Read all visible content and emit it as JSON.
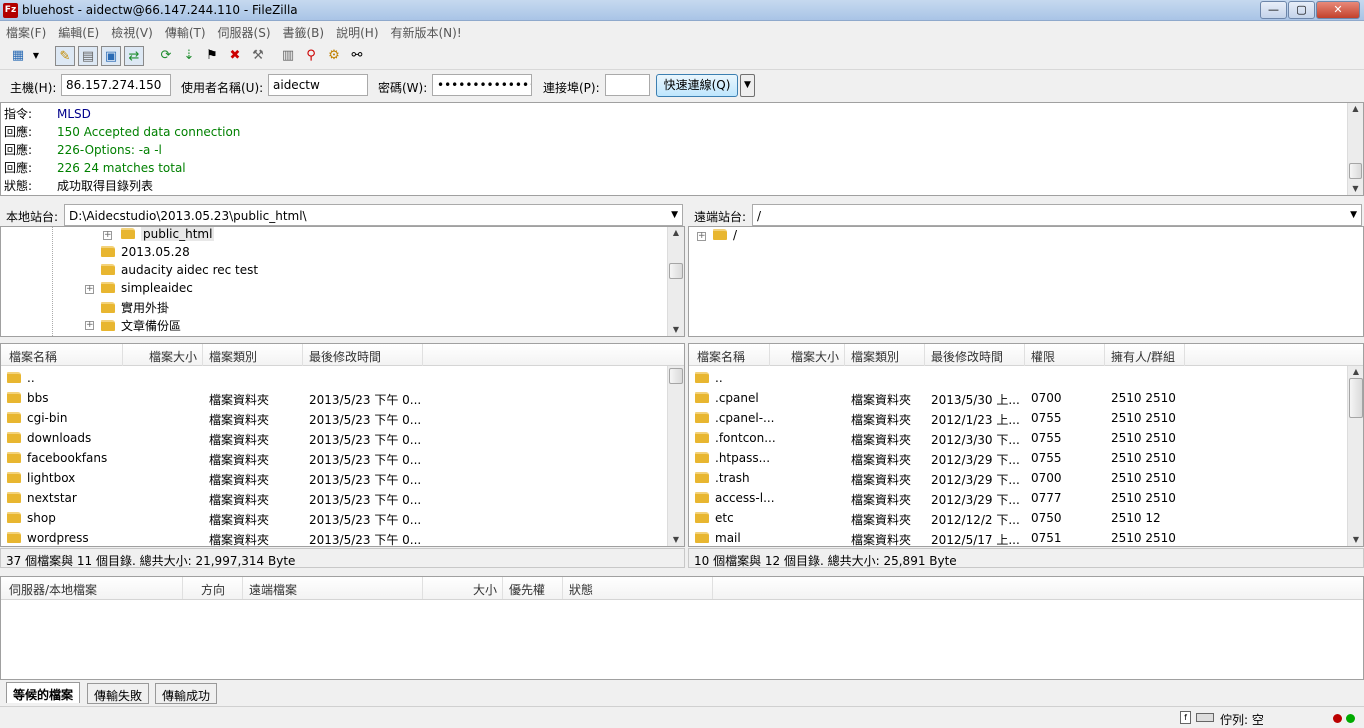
{
  "window": {
    "title": "bluehost - aidectw@66.147.244.110 - FileZilla",
    "app_icon": "Fz",
    "min": "—",
    "max": "▢",
    "close": "✕"
  },
  "menu": [
    "檔案(F)",
    "編輯(E)",
    "檢視(V)",
    "傳輸(T)",
    "伺服器(S)",
    "書籤(B)",
    "說明(H)",
    "有新版本(N)!"
  ],
  "quickconnect": {
    "host_label": "主機(H):",
    "host": "86.157.274.150",
    "user_label": "使用者名稱(U):",
    "user": "aidectw",
    "pass_label": "密碼(W):",
    "pass": "••••••••••••••",
    "port_label": "連接埠(P):",
    "port": "",
    "button": "快速連線(Q)"
  },
  "log": [
    {
      "k": "指令:",
      "v": "MLSD",
      "color": "#00008b"
    },
    {
      "k": "回應:",
      "v": "150 Accepted data connection",
      "color": "#008000"
    },
    {
      "k": "回應:",
      "v": "226-Options: -a -l",
      "color": "#008000"
    },
    {
      "k": "回應:",
      "v": "226 24 matches total",
      "color": "#008000"
    },
    {
      "k": "狀態:",
      "v": "成功取得目錄列表",
      "color": "#000000"
    }
  ],
  "local": {
    "site_label": "本地站台:",
    "path": "D:\\Aidecstudio\\2013.05.23\\public_html\\",
    "tree": [
      "public_html",
      "2013.05.28",
      "audacity aidec rec test",
      "simpleaidec",
      "實用外掛",
      "文章備份區"
    ],
    "headers": [
      "檔案名稱",
      "檔案大小",
      "檔案類別",
      "最後修改時間"
    ],
    "files": [
      {
        "name": "..",
        "size": "",
        "type": "",
        "mtime": ""
      },
      {
        "name": "bbs",
        "size": "",
        "type": "檔案資料夾",
        "mtime": "2013/5/23 下午 0..."
      },
      {
        "name": "cgi-bin",
        "size": "",
        "type": "檔案資料夾",
        "mtime": "2013/5/23 下午 0..."
      },
      {
        "name": "downloads",
        "size": "",
        "type": "檔案資料夾",
        "mtime": "2013/5/23 下午 0..."
      },
      {
        "name": "facebookfans",
        "size": "",
        "type": "檔案資料夾",
        "mtime": "2013/5/23 下午 0..."
      },
      {
        "name": "lightbox",
        "size": "",
        "type": "檔案資料夾",
        "mtime": "2013/5/23 下午 0..."
      },
      {
        "name": "nextstar",
        "size": "",
        "type": "檔案資料夾",
        "mtime": "2013/5/23 下午 0..."
      },
      {
        "name": "shop",
        "size": "",
        "type": "檔案資料夾",
        "mtime": "2013/5/23 下午 0..."
      },
      {
        "name": "wordpress",
        "size": "",
        "type": "檔案資料夾",
        "mtime": "2013/5/23 下午 0..."
      }
    ],
    "status": "37 個檔案與 11 個目錄. 總共大小: 21,997,314 Byte"
  },
  "remote": {
    "site_label": "遠端站台:",
    "path": "/",
    "tree": [
      "/"
    ],
    "headers": [
      "檔案名稱",
      "檔案大小",
      "檔案類別",
      "最後修改時間",
      "權限",
      "擁有人/群組"
    ],
    "files": [
      {
        "name": "..",
        "size": "",
        "type": "",
        "mtime": "",
        "perm": "",
        "owner": ""
      },
      {
        "name": ".cpanel",
        "size": "",
        "type": "檔案資料夾",
        "mtime": "2013/5/30 上...",
        "perm": "0700",
        "owner": "2510 2510"
      },
      {
        "name": ".cpanel-...",
        "size": "",
        "type": "檔案資料夾",
        "mtime": "2012/1/23 上...",
        "perm": "0755",
        "owner": "2510 2510"
      },
      {
        "name": ".fontcon...",
        "size": "",
        "type": "檔案資料夾",
        "mtime": "2012/3/30 下...",
        "perm": "0755",
        "owner": "2510 2510"
      },
      {
        "name": ".htpass...",
        "size": "",
        "type": "檔案資料夾",
        "mtime": "2012/3/29 下...",
        "perm": "0755",
        "owner": "2510 2510"
      },
      {
        "name": ".trash",
        "size": "",
        "type": "檔案資料夾",
        "mtime": "2012/3/29 下...",
        "perm": "0700",
        "owner": "2510 2510"
      },
      {
        "name": "access-l...",
        "size": "",
        "type": "檔案資料夾",
        "mtime": "2012/3/29 下...",
        "perm": "0777",
        "owner": "2510 2510"
      },
      {
        "name": "etc",
        "size": "",
        "type": "檔案資料夾",
        "mtime": "2012/12/2 下...",
        "perm": "0750",
        "owner": "2510 12"
      },
      {
        "name": "mail",
        "size": "",
        "type": "檔案資料夾",
        "mtime": "2012/5/17 上...",
        "perm": "0751",
        "owner": "2510 2510"
      }
    ],
    "status": "10 個檔案與 12 個目錄. 總共大小: 25,891 Byte"
  },
  "queue": {
    "headers": [
      "伺服器/本地檔案",
      "方向",
      "遠端檔案",
      "大小",
      "優先權",
      "狀態"
    ]
  },
  "tabs": [
    "等候的檔案",
    "傳輸失敗",
    "傳輸成功"
  ],
  "statusbar": {
    "queue": "佇列: 空"
  },
  "icons": [
    "site-manager-icon",
    "toggle-log-icon",
    "toggle-local-tree-icon",
    "toggle-remote-tree-icon",
    "toggle-queue-icon",
    "refresh-icon",
    "process-queue-icon",
    "cancel-icon",
    "disconnect-icon",
    "reconnect-icon",
    "compare-icon",
    "filter-icon",
    "sync-browse-icon",
    "search-icon"
  ]
}
